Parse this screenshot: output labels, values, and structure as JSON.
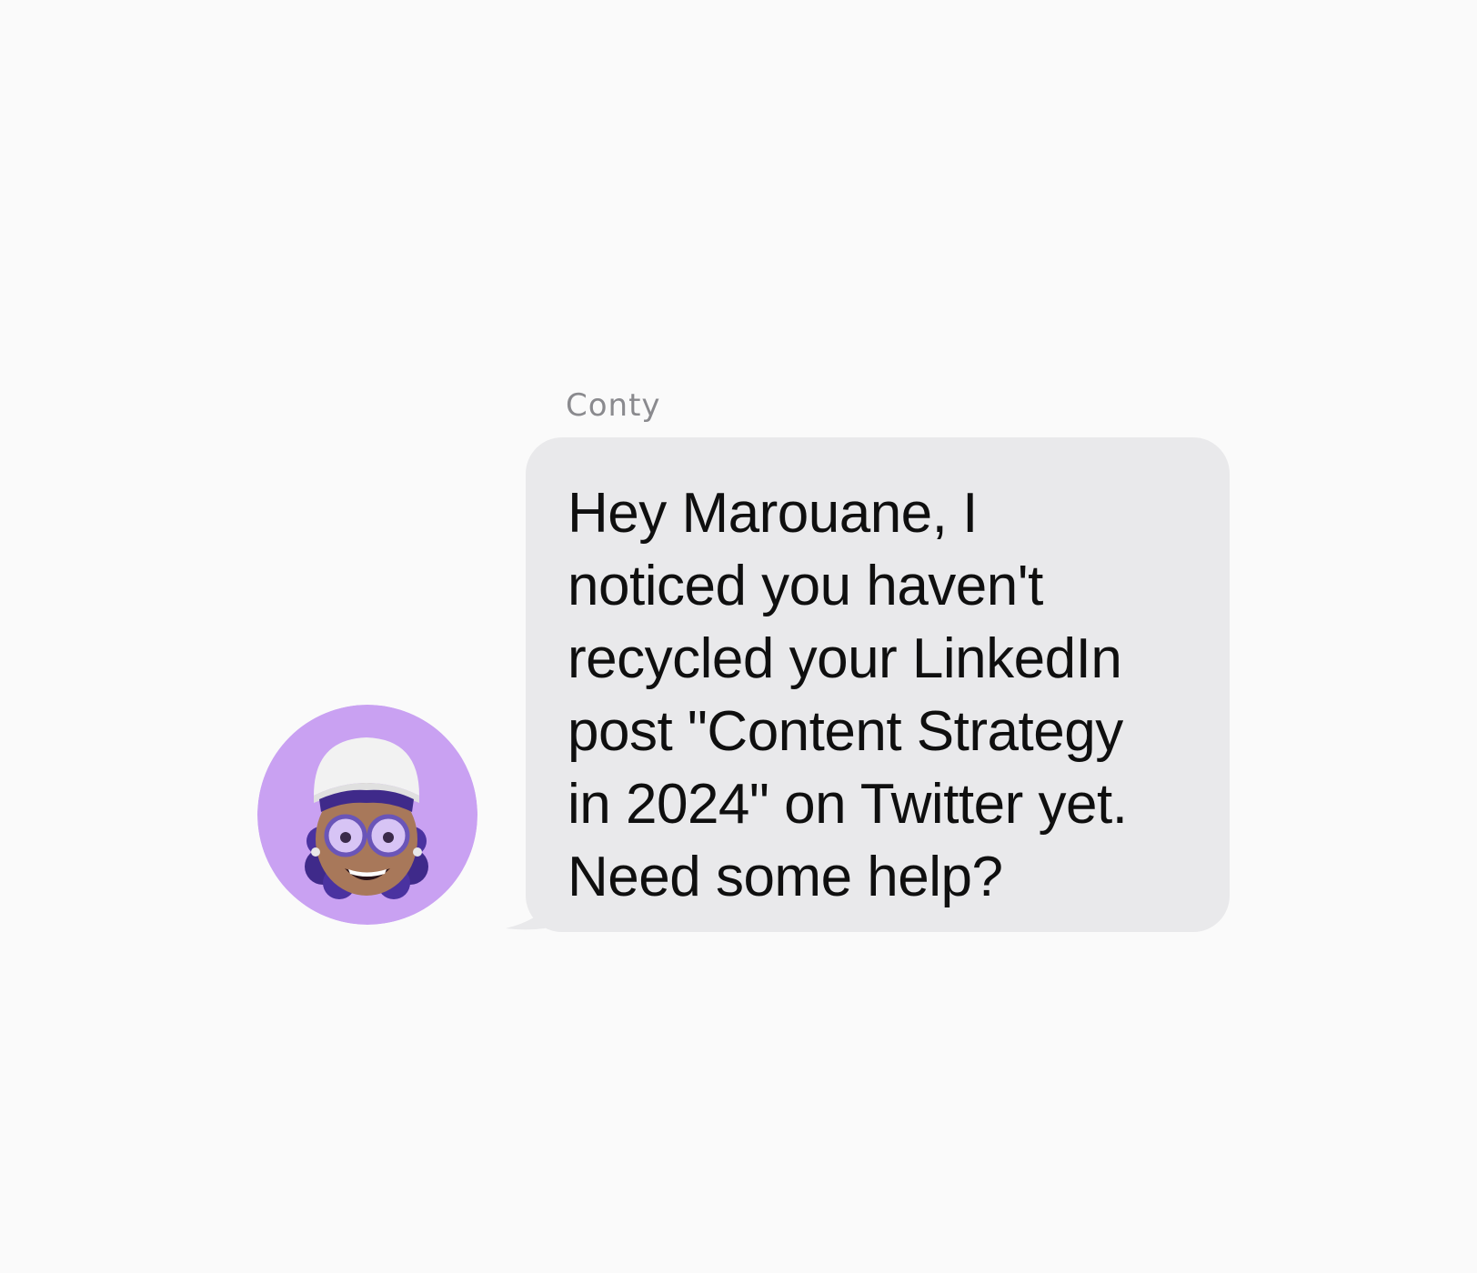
{
  "message": {
    "sender": "Conty",
    "text": "Hey Marouane, I\nnoticed you haven't\nrecycled your LinkedIn\npost \"Content Strategy\nin 2024\" on Twitter yet.\nNeed some help?",
    "avatar_icon": "memoji-avatar-icon"
  },
  "colors": {
    "background": "#fafafa",
    "bubble": "#e9e9eb",
    "avatar_bg": "#c9a1f2",
    "sender_text": "#8a8a8e",
    "message_text": "#0f0f0f"
  }
}
